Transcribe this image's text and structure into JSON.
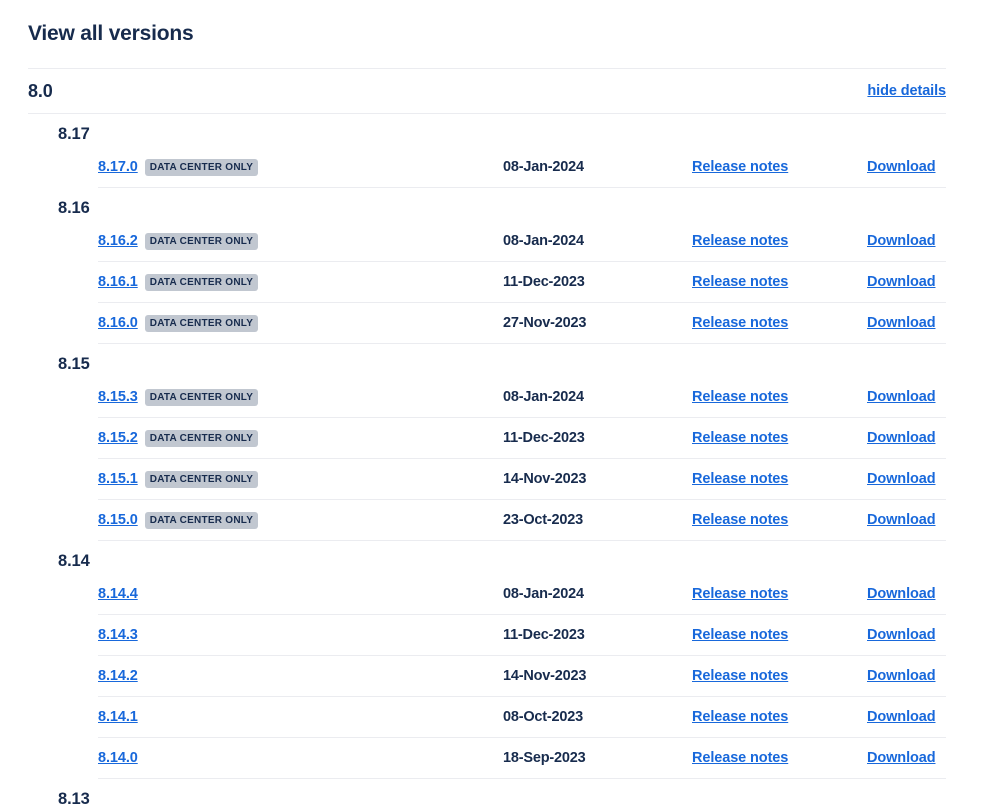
{
  "page": {
    "title": "View all versions"
  },
  "major": {
    "label": "8.0",
    "toggle_label": "hide details"
  },
  "columns": {
    "release_notes_label": "Release notes",
    "download_label": "Download"
  },
  "badges": {
    "data_center_only": "DATA CENTER ONLY"
  },
  "colors": {
    "link": "#1868DB",
    "text": "#172B4D",
    "badge_bg": "#C1C7D0",
    "divider": "#EBECF0"
  },
  "groups": [
    {
      "label": "8.17",
      "rows": [
        {
          "version": "8.17.0",
          "badge": "DATA CENTER ONLY",
          "date": "08-Jan-2024",
          "notes": "Release notes",
          "download": "Download"
        }
      ]
    },
    {
      "label": "8.16",
      "rows": [
        {
          "version": "8.16.2",
          "badge": "DATA CENTER ONLY",
          "date": "08-Jan-2024",
          "notes": "Release notes",
          "download": "Download"
        },
        {
          "version": "8.16.1",
          "badge": "DATA CENTER ONLY",
          "date": "11-Dec-2023",
          "notes": "Release notes",
          "download": "Download"
        },
        {
          "version": "8.16.0",
          "badge": "DATA CENTER ONLY",
          "date": "27-Nov-2023",
          "notes": "Release notes",
          "download": "Download"
        }
      ]
    },
    {
      "label": "8.15",
      "rows": [
        {
          "version": "8.15.3",
          "badge": "DATA CENTER ONLY",
          "date": "08-Jan-2024",
          "notes": "Release notes",
          "download": "Download"
        },
        {
          "version": "8.15.2",
          "badge": "DATA CENTER ONLY",
          "date": "11-Dec-2023",
          "notes": "Release notes",
          "download": "Download"
        },
        {
          "version": "8.15.1",
          "badge": "DATA CENTER ONLY",
          "date": "14-Nov-2023",
          "notes": "Release notes",
          "download": "Download"
        },
        {
          "version": "8.15.0",
          "badge": "DATA CENTER ONLY",
          "date": "23-Oct-2023",
          "notes": "Release notes",
          "download": "Download"
        }
      ]
    },
    {
      "label": "8.14",
      "rows": [
        {
          "version": "8.14.4",
          "badge": "",
          "date": "08-Jan-2024",
          "notes": "Release notes",
          "download": "Download"
        },
        {
          "version": "8.14.3",
          "badge": "",
          "date": "11-Dec-2023",
          "notes": "Release notes",
          "download": "Download"
        },
        {
          "version": "8.14.2",
          "badge": "",
          "date": "14-Nov-2023",
          "notes": "Release notes",
          "download": "Download"
        },
        {
          "version": "8.14.1",
          "badge": "",
          "date": "08-Oct-2023",
          "notes": "Release notes",
          "download": "Download"
        },
        {
          "version": "8.14.0",
          "badge": "",
          "date": "18-Sep-2023",
          "notes": "Release notes",
          "download": "Download"
        }
      ]
    },
    {
      "label": "8.13",
      "rows": []
    }
  ]
}
